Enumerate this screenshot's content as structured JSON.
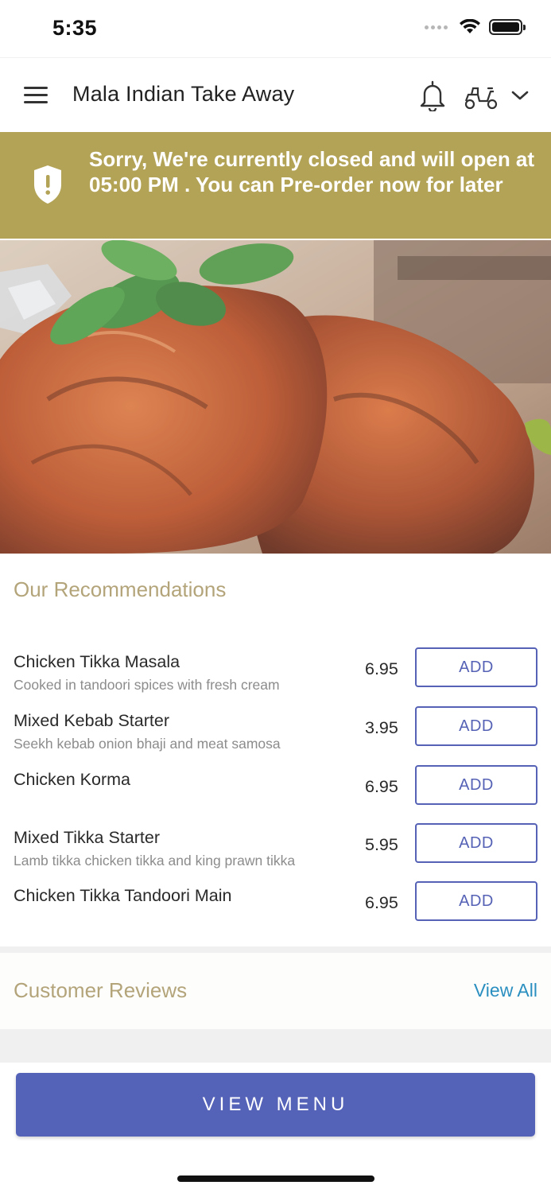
{
  "status_bar": {
    "time": "5:35"
  },
  "header": {
    "title": "Mala Indian Take Away",
    "menu_icon": "hamburger-menu-icon",
    "notification_icon": "bell-icon",
    "delivery_icon": "scooter-icon",
    "dropdown_icon": "chevron-down-icon"
  },
  "banner": {
    "text": "Sorry, We're currently closed and will open at 05:00 PM . You can Pre-order now for later",
    "icon": "shield-alert-icon",
    "background": "#b3a356"
  },
  "recommendations": {
    "title": "Our Recommendations",
    "add_label": "ADD",
    "items": [
      {
        "name": "Chicken Tikka Masala",
        "description": "Cooked in tandoori spices with fresh cream",
        "price": "6.95"
      },
      {
        "name": "Mixed Kebab Starter",
        "description": "Seekh kebab onion bhaji and meat samosa",
        "price": "3.95"
      },
      {
        "name": "Chicken Korma",
        "description": "",
        "price": "6.95"
      },
      {
        "name": "Mixed Tikka Starter",
        "description": "Lamb tikka chicken tikka and king prawn tikka",
        "price": "5.95"
      },
      {
        "name": "Chicken Tikka Tandoori Main",
        "description": "",
        "price": "6.95"
      }
    ]
  },
  "reviews": {
    "title": "Customer Reviews",
    "view_all": "View All"
  },
  "footer": {
    "view_menu": "VIEW MENU"
  },
  "colors": {
    "accent": "#5462b8",
    "gold": "#b3a356",
    "link": "#2b8fc0"
  }
}
